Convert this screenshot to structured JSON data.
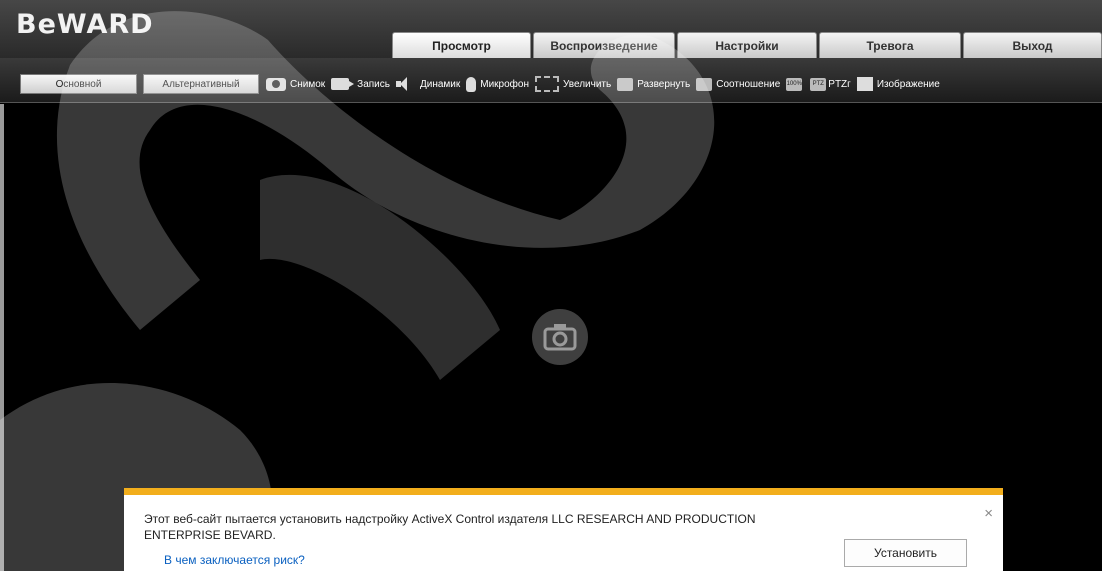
{
  "header": {
    "logo": "BeWARD"
  },
  "tabs": [
    {
      "label": "Просмотр",
      "active": true
    },
    {
      "label": "Воспроизведение",
      "active": false
    },
    {
      "label": "Настройки",
      "active": false
    },
    {
      "label": "Тревога",
      "active": false
    },
    {
      "label": "Выход",
      "active": false
    }
  ],
  "streams": {
    "main": "Основной",
    "alt": "Альтернативный"
  },
  "tools": {
    "snapshot": "Снимок",
    "record": "Запись",
    "speaker": "Динамик",
    "microphone": "Микрофон",
    "zoom": "Увеличить",
    "expand": "Развернуть",
    "ratio": "Соотношение",
    "ratio_icon": "100%",
    "ptz_icon": "PTZ",
    "ptz": "PTZг",
    "image": "Изображение"
  },
  "notification": {
    "message": "Этот веб-сайт пытается установить надстройку ActiveX Control издателя LLC RESEARCH AND PRODUCTION ENTERPRISE BEVARD.",
    "risk_link": "В чем заключается риск?",
    "install": "Установить",
    "close": "×"
  },
  "colors": {
    "accent": "#f2ae1c",
    "link": "#0a60c0"
  }
}
